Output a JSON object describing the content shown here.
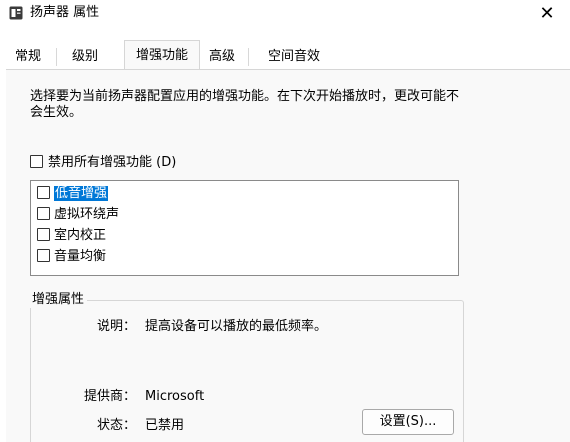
{
  "window": {
    "title": "扬声器 属性",
    "icon": "speaker-properties-icon",
    "close_glyph": "✕"
  },
  "tabs": [
    {
      "label": "常规",
      "active": false
    },
    {
      "label": "级别",
      "active": false
    },
    {
      "label": "增强功能",
      "active": true
    },
    {
      "label": "高级",
      "active": false
    },
    {
      "label": "空间音效",
      "active": false
    }
  ],
  "enhancements": {
    "description": "选择要为当前扬声器配置应用的增强功能。在下次开始播放时，更改可能不会生效。",
    "disable_all": {
      "label": "禁用所有增强功能 (D)",
      "checked": false
    },
    "list": [
      {
        "label": "低音增强",
        "checked": false,
        "selected": true
      },
      {
        "label": "虚拟环绕声",
        "checked": false,
        "selected": false
      },
      {
        "label": "室内校正",
        "checked": false,
        "selected": false
      },
      {
        "label": "音量均衡",
        "checked": false,
        "selected": false
      }
    ]
  },
  "properties": {
    "group_title": "增强属性",
    "description_label": "说明：",
    "description_value": "提高设备可以播放的最低频率。",
    "provider_label": "提供商：",
    "provider_value": "Microsoft",
    "status_label": "状态：",
    "status_value": "已禁用",
    "settings_button": "设置(S)..."
  },
  "colors": {
    "selection": "#0078d7",
    "panel_background": "#f9f9f9"
  }
}
